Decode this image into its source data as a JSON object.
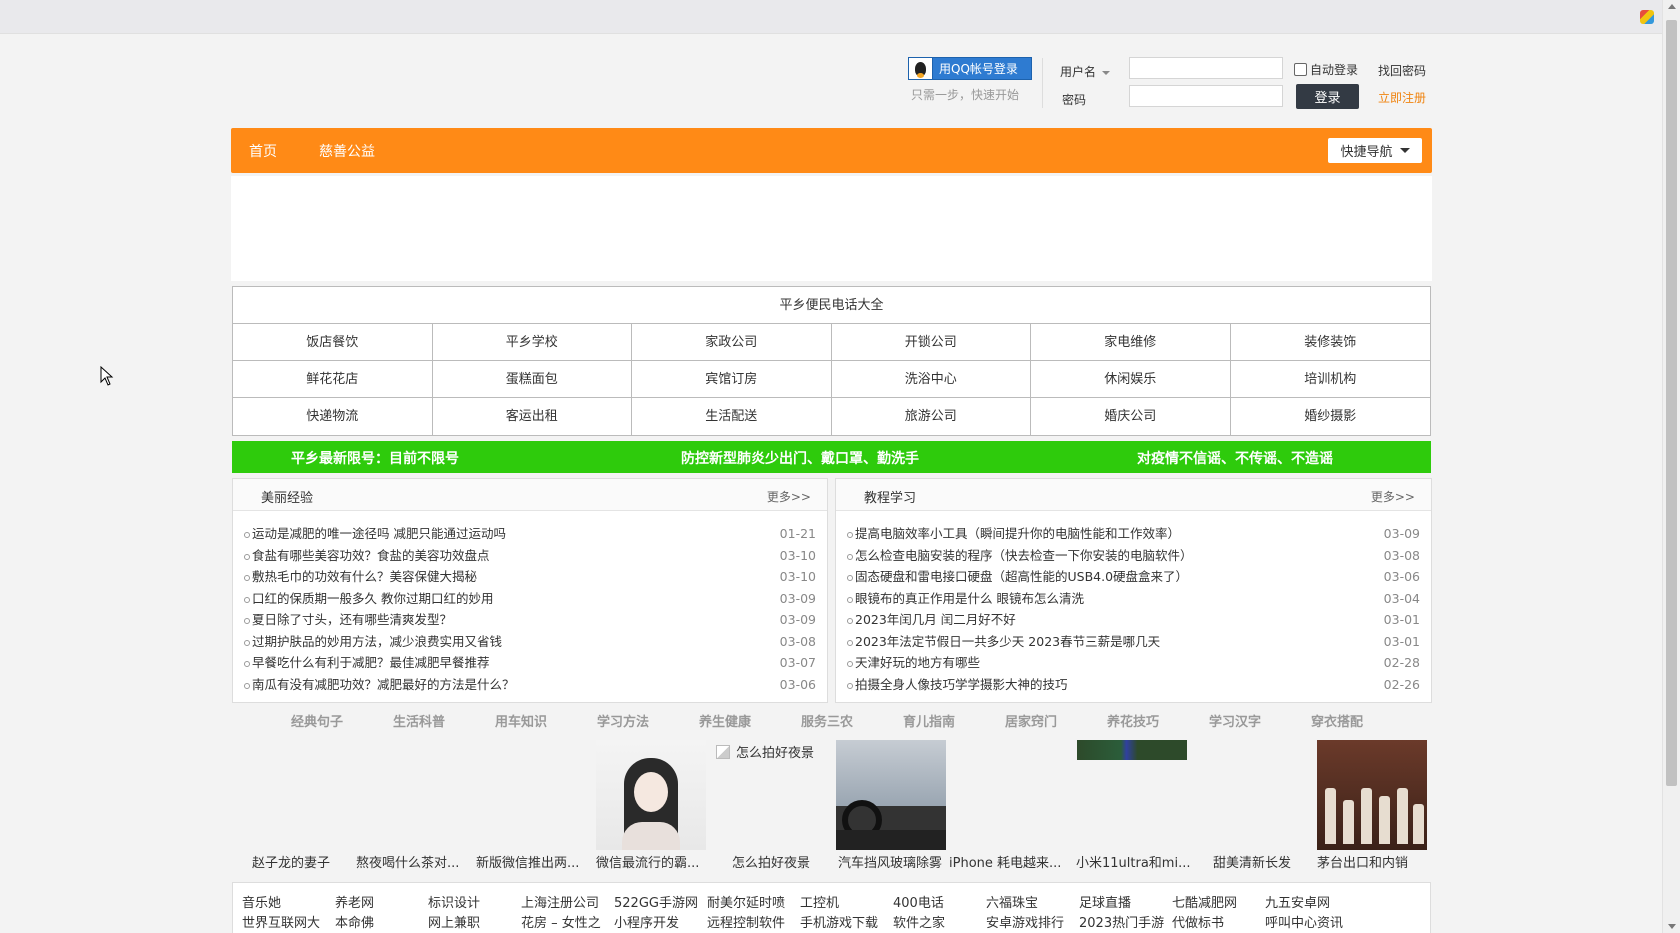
{
  "login": {
    "qq_button": "用QQ帐号登录",
    "qq_sub": "只需一步，快速开始",
    "username_label": "用户名",
    "password_label": "密码",
    "auto_login": "自动登录",
    "find_password": "找回密码",
    "login_button": "登录",
    "register": "立即注册"
  },
  "nav": {
    "items": [
      "首页",
      "慈善公益"
    ],
    "quick_nav": "快捷导航"
  },
  "phone": {
    "title": "平乡便民电话大全",
    "cells": [
      "饭店餐饮",
      "平乡学校",
      "家政公司",
      "开锁公司",
      "家电维修",
      "装修装饰",
      "鲜花花店",
      "蛋糕面包",
      "宾馆订房",
      "洗浴中心",
      "休闲娱乐",
      "培训机构",
      "快递物流",
      "客运出租",
      "生活配送",
      "旅游公司",
      "婚庆公司",
      "婚纱摄影"
    ]
  },
  "notice": [
    "平乡最新限号：目前不限号",
    "防控新型肺炎少出门、戴口罩、勤洗手",
    "对疫情不信谣、不传谣、不造谣"
  ],
  "left_panel": {
    "title": "美丽经验",
    "more": "更多>>",
    "items": [
      {
        "title": "运动是减肥的唯一途径吗 减肥只能通过运动吗",
        "date": "01-21"
      },
      {
        "title": "食盐有哪些美容功效？食盐的美容功效盘点",
        "date": "03-10"
      },
      {
        "title": "敷热毛巾的功效有什么？美容保健大揭秘",
        "date": "03-10"
      },
      {
        "title": "口红的保质期一般多久 教你过期口红的妙用",
        "date": "03-09"
      },
      {
        "title": "夏日除了寸头，还有哪些清爽发型？",
        "date": "03-09"
      },
      {
        "title": "过期护肤品的妙用方法，减少浪费实用又省钱",
        "date": "03-08"
      },
      {
        "title": "早餐吃什么有利于减肥？最佳减肥早餐推荐",
        "date": "03-07"
      },
      {
        "title": "南瓜有没有减肥功效？减肥最好的方法是什么？",
        "date": "03-06"
      }
    ]
  },
  "right_panel": {
    "title": "教程学习",
    "more": "更多>>",
    "items": [
      {
        "title": "提高电脑效率小工具（瞬间提升你的电脑性能和工作效率）",
        "date": "03-09"
      },
      {
        "title": "怎么检查电脑安装的程序（快去检查一下你安装的电脑软件）",
        "date": "03-08"
      },
      {
        "title": "固态硬盘和雷电接口硬盘（超高性能的USB4.0硬盘盒来了）",
        "date": "03-06"
      },
      {
        "title": "眼镜布的真正作用是什么 眼镜布怎么清洗",
        "date": "03-04"
      },
      {
        "title": "2023年闰几月 闰二月好不好",
        "date": "03-01"
      },
      {
        "title": "2023年法定节假日一共多少天 2023春节三薪是哪几天",
        "date": "03-01"
      },
      {
        "title": "天津好玩的地方有哪些",
        "date": "02-28"
      },
      {
        "title": "拍摄全身人像技巧学学摄影大神的技巧",
        "date": "02-26"
      }
    ]
  },
  "categories": [
    "经典句子",
    "生活科普",
    "用车知识",
    "学习方法",
    "养生健康",
    "服务三农",
    "育儿指南",
    "居家窍门",
    "养花技巧",
    "学习汉字",
    "穿衣搭配"
  ],
  "thumbs": {
    "broken_alt": "怎么拍好夜景",
    "captions": [
      "赵子龙的妻子",
      "熬夜喝什么茶对...",
      "新版微信推出两...",
      "微信最流行的霸...",
      "怎么拍好夜景",
      "汽车挡风玻璃除雾",
      "iPhone 耗电越来...",
      "小米11ultra和mi...",
      "甜美清新长发",
      "茅台出口和内销"
    ]
  },
  "links": {
    "row1": [
      "音乐她",
      "养老网",
      "标识设计",
      "上海注册公司",
      "522GG手游网",
      "耐美尔延时喷",
      "工控机",
      "400电话",
      "六福珠宝",
      "足球直播",
      "七酷减肥网",
      "九五安卓网"
    ],
    "row2": [
      "世界互联网大",
      "本命佛",
      "网上兼职",
      "花房 – 女性之",
      "小程序开发",
      "远程控制软件",
      "手机游戏下载",
      "软件之家",
      "安卓游戏排行",
      "2023热门手游",
      "代做标书",
      "呼叫中心资讯"
    ]
  },
  "colors": {
    "nav": "#ff8a16",
    "notice": "#2ecb0c",
    "register": "#f08410",
    "qq": "#2e7bd1"
  }
}
